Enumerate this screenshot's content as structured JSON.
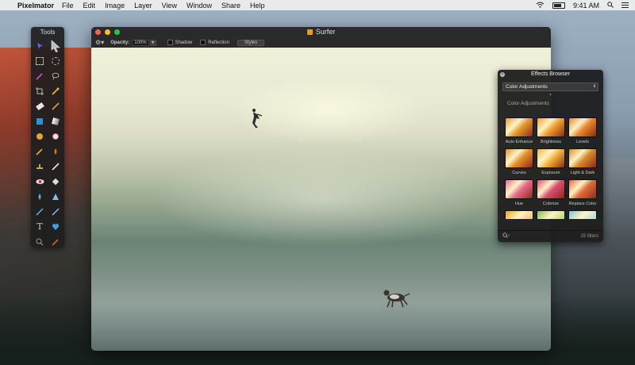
{
  "menubar": {
    "app_name": "Pixelmator",
    "items": [
      "File",
      "Edit",
      "Image",
      "Layer",
      "View",
      "Window",
      "Share",
      "Help"
    ],
    "time": "9:41 AM"
  },
  "tools_palette": {
    "title": "Tools",
    "tools": [
      "move-tool",
      "arrange-tool",
      "rect-select-tool",
      "ellipse-select-tool",
      "magic-wand-tool",
      "lasso-tool",
      "crop-tool",
      "eyedropper-tool",
      "eraser-tool",
      "pencil-tool",
      "shape-tool",
      "gradient-tool",
      "paint-bucket-tool",
      "brush-tool",
      "smudge-tool",
      "clone-stamp-tool",
      "heal-tool",
      "burn-tool",
      "red-eye-tool",
      "blur-tool",
      "sharpen-tool",
      "sponge-tool",
      "pen-tool",
      "freeform-pen-tool",
      "type-tool",
      "color-fill-tool",
      "zoom-tool",
      "color-picker-tool"
    ]
  },
  "window": {
    "title": "Surfer",
    "toolbar": {
      "opacity_label": "Opacity:",
      "opacity_value": "100%",
      "shadow_label": "Shadow",
      "reflection_label": "Reflection",
      "styles_label": "Styles"
    }
  },
  "effects_browser": {
    "title": "Effects Browser",
    "category": "Color Adjustments",
    "section_title": "Color Adjustments",
    "effects": [
      {
        "label": "Auto Enhance",
        "swatch": "#e39a2b"
      },
      {
        "label": "Brightness",
        "swatch": "#f0a02a"
      },
      {
        "label": "Levels",
        "swatch": "#e8862a"
      },
      {
        "label": "Curves",
        "swatch": "#e48f2a"
      },
      {
        "label": "Exposure",
        "swatch": "#f2b23a"
      },
      {
        "label": "Light & Dark",
        "swatch": "#d8892c"
      },
      {
        "label": "Hue",
        "swatch": "#e86a8a"
      },
      {
        "label": "Colorize",
        "swatch": "#d84f6f"
      },
      {
        "label": "Replace Color",
        "swatch": "#e06b3a"
      }
    ],
    "partial_row_swatches": [
      "#e8a22a",
      "#7fbf4a",
      "#7ac8e0"
    ],
    "filter_count": "15 filters"
  }
}
